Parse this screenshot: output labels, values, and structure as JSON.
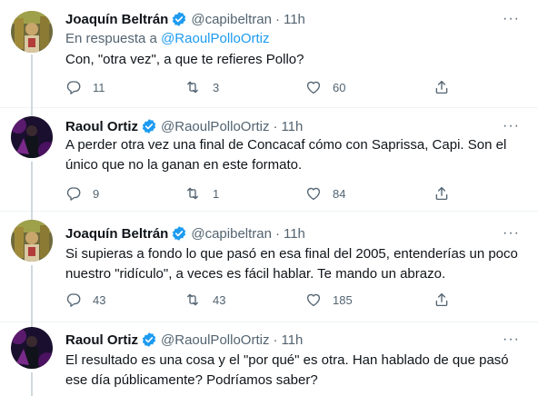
{
  "tweets": [
    {
      "name": "Joaquín Beltrán",
      "handle": "@capibeltran",
      "time": "11h",
      "reply_prefix": "En respuesta a",
      "reply_handle": "@RaoulPolloOrtiz",
      "text": "Con, \"otra vez\", a que te refieres Pollo?",
      "replies": "11",
      "retweets": "3",
      "likes": "60",
      "avatar": "capibeltran-avatar"
    },
    {
      "name": "Raoul Ortiz",
      "handle": "@RaoulPolloOrtiz",
      "time": "11h",
      "text": "A perder otra vez una final de Concacaf cómo con Saprissa, Capi. Son el único que no la ganan en este formato.",
      "replies": "9",
      "retweets": "1",
      "likes": "84",
      "avatar": "raoulortiz-avatar"
    },
    {
      "name": "Joaquín Beltrán",
      "handle": "@capibeltran",
      "time": "11h",
      "text": "Si supieras a fondo lo que pasó en esa final del 2005, entenderías un poco nuestro \"ridículo\", a veces es fácil hablar. Te mando un abrazo.",
      "replies": "43",
      "retweets": "43",
      "likes": "185",
      "avatar": "capibeltran-avatar"
    },
    {
      "name": "Raoul Ortiz",
      "handle": "@RaoulPolloOrtiz",
      "time": "11h",
      "text": "El resultado es una cosa y el \"por qué\" es otra. Han hablado de que pasó ese día públicamente? Podríamos saber?",
      "avatar": "raoulortiz-avatar"
    }
  ],
  "ui": {
    "dot": "·",
    "more": "···"
  },
  "colors": {
    "text": "#0f1419",
    "secondary": "#536471",
    "accent": "#1d9bf0",
    "divider": "#eff3f4",
    "connector": "#cfd9de"
  },
  "icons": [
    "verified-badge-icon",
    "reply-icon",
    "retweet-icon",
    "like-icon",
    "share-icon",
    "more-icon"
  ]
}
